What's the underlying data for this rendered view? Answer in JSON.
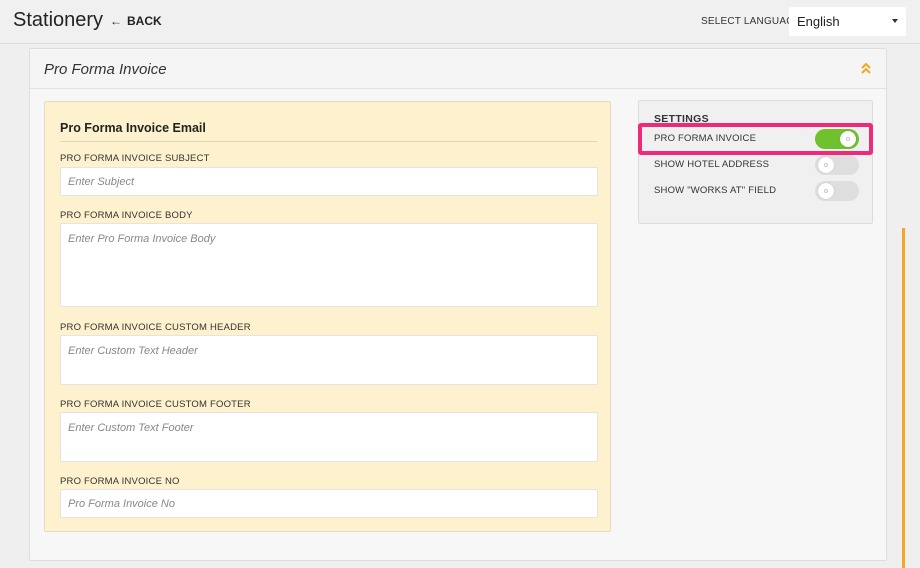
{
  "header": {
    "title": "Stationery",
    "back_label": "BACK",
    "language_label": "SELECT LANGUAGE",
    "language_value": "English"
  },
  "card": {
    "title": "Pro Forma Invoice"
  },
  "email_form": {
    "heading": "Pro Forma Invoice Email",
    "fields": [
      {
        "label": "PRO FORMA INVOICE SUBJECT",
        "placeholder": "Enter Subject",
        "value": ""
      },
      {
        "label": "PRO FORMA INVOICE BODY",
        "placeholder": "Enter Pro Forma Invoice Body",
        "value": ""
      },
      {
        "label": "PRO FORMA INVOICE CUSTOM HEADER",
        "placeholder": "Enter Custom Text Header",
        "value": ""
      },
      {
        "label": "PRO FORMA INVOICE CUSTOM FOOTER",
        "placeholder": "Enter Custom Text Footer",
        "value": ""
      },
      {
        "label": "PRO FORMA INVOICE NO",
        "placeholder": "Pro Forma Invoice No",
        "value": ""
      }
    ]
  },
  "settings": {
    "title": "SETTINGS",
    "items": [
      {
        "label": "PRO FORMA INVOICE",
        "enabled": true
      },
      {
        "label": "SHOW HOTEL ADDRESS",
        "enabled": false
      },
      {
        "label": "SHOW \"WORKS AT\" FIELD",
        "enabled": false
      }
    ]
  },
  "colors": {
    "toggle_on": "#6fc22e",
    "toggle_off": "#dedede",
    "highlight": "#ee2a7b",
    "accent": "#f5a623",
    "form_panel_bg": "#fdf2cd"
  },
  "icons": {
    "back": "arrow-left-icon",
    "collapse": "chevron-double-up-icon",
    "select": "caret-down-icon"
  }
}
